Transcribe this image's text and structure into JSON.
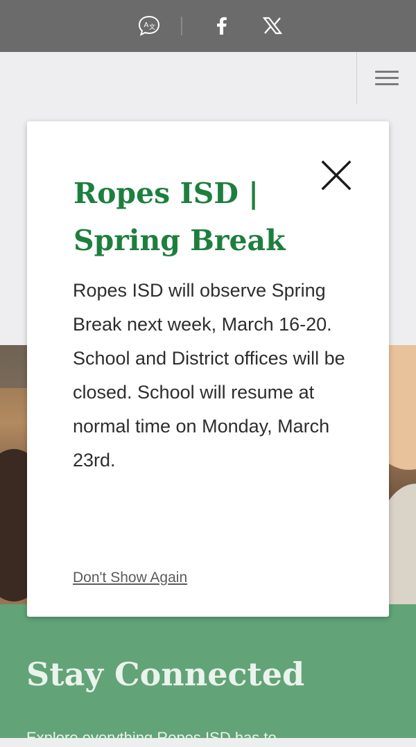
{
  "topbar": {
    "icons": {
      "translate": "translate-icon",
      "facebook": "facebook-icon",
      "x": "x-icon"
    }
  },
  "header": {
    "menu_icon": "hamburger-menu-icon"
  },
  "modal": {
    "title": "Ropes ISD | Spring Break",
    "body": "Ropes ISD will observe Spring Break next week, March 16-20. School and District offices will be closed. School will resume at normal time on Monday, March 23rd.",
    "close_icon": "close-icon",
    "dont_show_label": "Don't Show Again"
  },
  "connect": {
    "title": "Stay Connected",
    "subtitle": "Explore everything Ropes ISD has to"
  },
  "colors": {
    "topbar_bg": "#6b6b6b",
    "page_bg": "#eeeef0",
    "title_green": "#1d7f3e",
    "connect_bg": "#62a378"
  }
}
